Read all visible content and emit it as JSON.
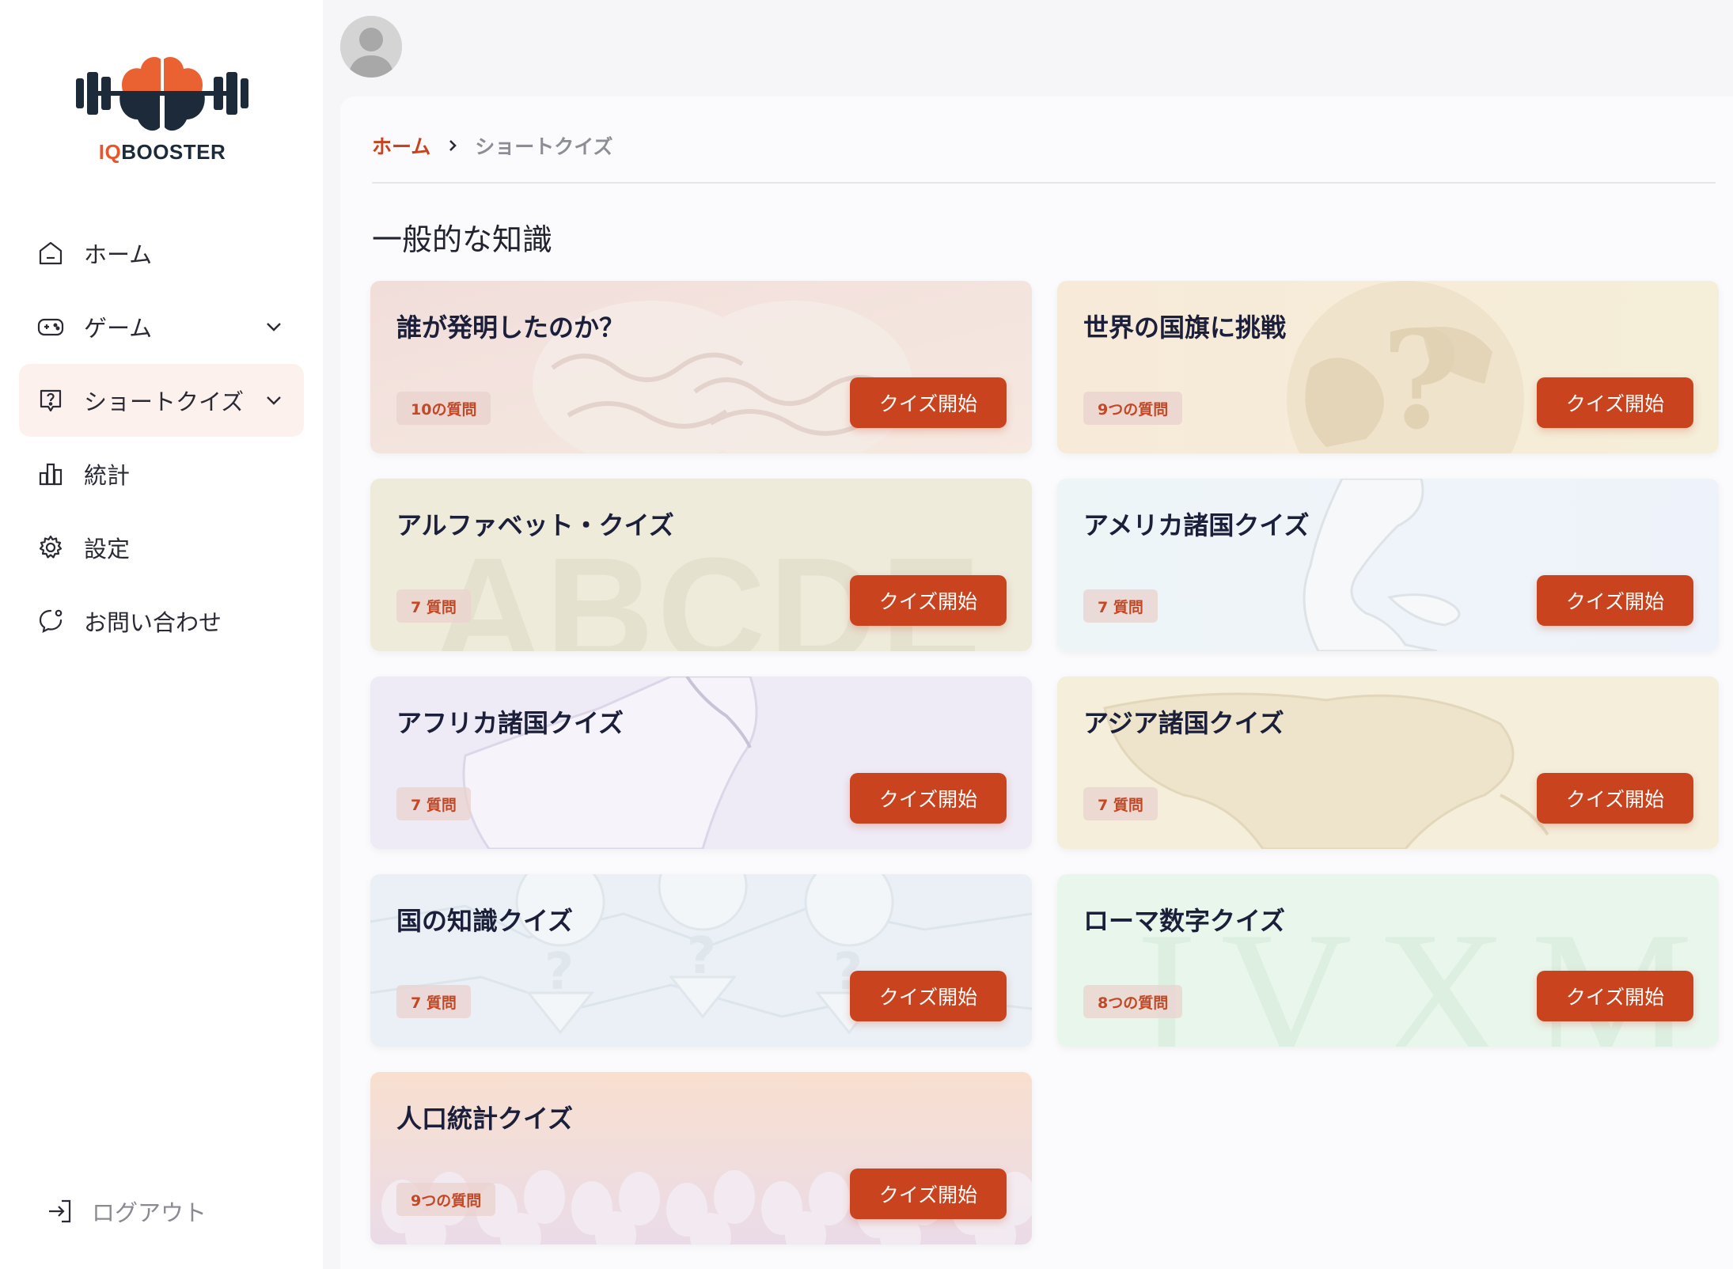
{
  "brand": {
    "logo_prefix": "IQ",
    "logo_suffix": "BOOSTER",
    "accent_color": "#c8431e"
  },
  "sidebar": {
    "items": [
      {
        "label": "ホーム",
        "icon": "home-icon",
        "active": false,
        "has_chevron": false
      },
      {
        "label": "ゲーム",
        "icon": "gamepad-icon",
        "active": false,
        "has_chevron": true
      },
      {
        "label": "ショートクイズ",
        "icon": "question-bubble-icon",
        "active": true,
        "has_chevron": true
      },
      {
        "label": "統計",
        "icon": "bar-chart-icon",
        "active": false,
        "has_chevron": false
      },
      {
        "label": "設定",
        "icon": "gear-icon",
        "active": false,
        "has_chevron": false
      },
      {
        "label": "お問い合わせ",
        "icon": "chat-icon",
        "active": false,
        "has_chevron": false
      }
    ],
    "logout_label": "ログアウト"
  },
  "breadcrumb": {
    "home": "ホーム",
    "current": "ショートクイズ"
  },
  "section_title": "一般的な知識",
  "cards": [
    {
      "title": "誰が発明したのか？",
      "badge": "10の質問",
      "button": "クイズ開始",
      "theme": "brain"
    },
    {
      "title": "世界の国旗に挑戦",
      "badge": "9つの質問",
      "button": "クイズ開始",
      "theme": "globe"
    },
    {
      "title": "アルファベット・クイズ",
      "badge": "7 質問",
      "button": "クイズ開始",
      "theme": "alphabet",
      "bg_text": "ABCDE"
    },
    {
      "title": "アメリカ諸国クイズ",
      "badge": "7 質問",
      "button": "クイズ開始",
      "theme": "america"
    },
    {
      "title": "アフリカ諸国クイズ",
      "badge": "7 質問",
      "button": "クイズ開始",
      "theme": "africa"
    },
    {
      "title": "アジア諸国クイズ",
      "badge": "7 質問",
      "button": "クイズ開始",
      "theme": "asia"
    },
    {
      "title": "国の知識クイズ",
      "badge": "7 質問",
      "button": "クイズ開始",
      "theme": "pins"
    },
    {
      "title": "ローマ数字クイズ",
      "badge": "8つの質問",
      "button": "クイズ開始",
      "theme": "roman",
      "bg_text": "IVXM"
    },
    {
      "title": "人口統計クイズ",
      "badge": "9つの質問",
      "button": "クイズ開始",
      "theme": "people"
    }
  ]
}
